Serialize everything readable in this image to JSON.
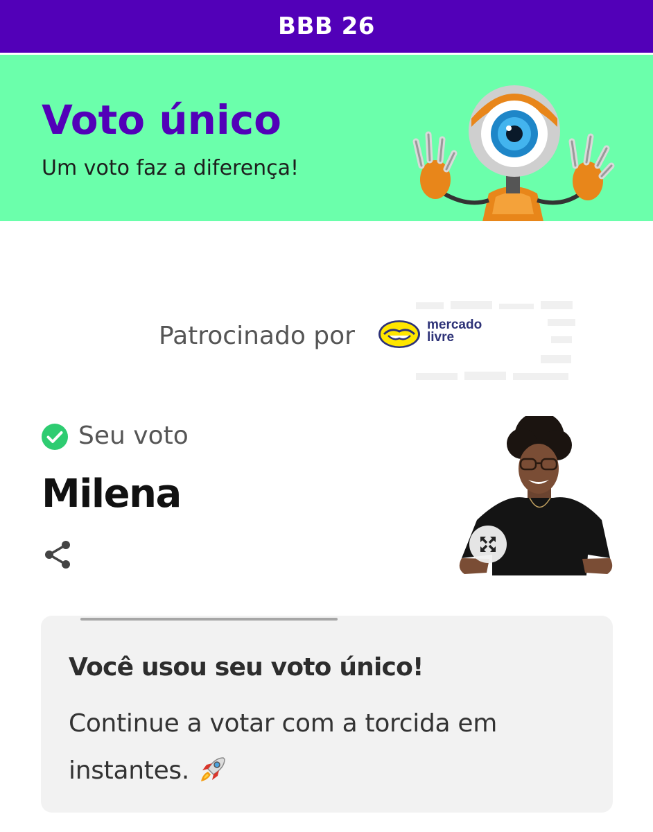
{
  "header": {
    "title": "BBB 26"
  },
  "hero": {
    "title": "Voto único",
    "subtitle": "Um voto faz a diferença!",
    "mascot_icon": "big-brother-eye-robot-mascot"
  },
  "sponsor": {
    "label": "Patrocinado por",
    "logo_text": "mercado livre",
    "logo_icon": "handshake-logo"
  },
  "vote": {
    "status_label": "Seu voto",
    "status_icon": "check-circle-icon",
    "candidate_name": "Milena",
    "share_icon": "share-icon",
    "expand_icon": "expand-icon"
  },
  "card": {
    "title": "Você usou seu voto único!",
    "body": "Continue a votar com a torcida em instantes.",
    "emoji_icon": "rocket-icon",
    "progress": 0.45
  },
  "colors": {
    "brand_purple": "#5200b8",
    "banner_green": "#6bffab",
    "check_green": "#2ecc71",
    "card_bg": "#f2f2f2",
    "mercado_yellow": "#ffe600",
    "mercado_navy": "#2d3277"
  }
}
